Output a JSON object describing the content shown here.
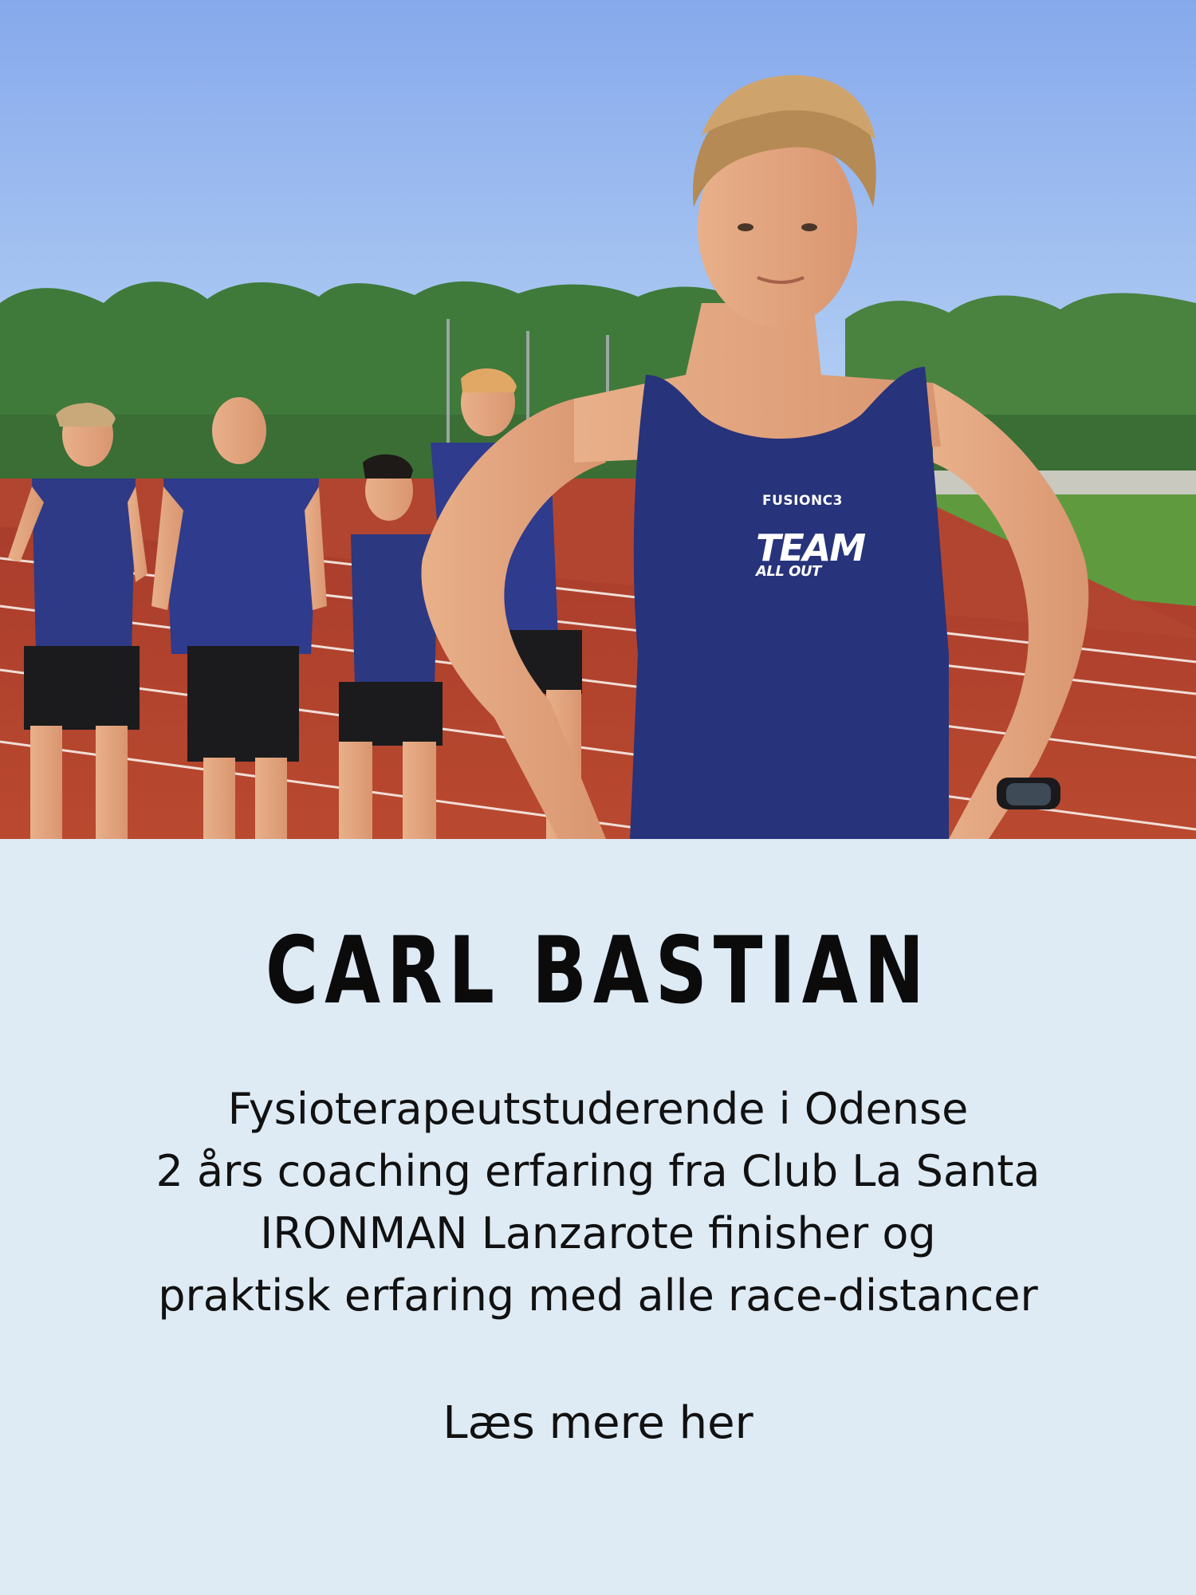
{
  "profile": {
    "name": "CARL BASTIAN",
    "bio_lines": [
      "Fysioterapeutstuderende i Odense",
      "2 års coaching  erfaring fra Club La Santa",
      "IRONMAN Lanzarote finisher  og",
      "praktisk erfaring med alle race-distancer"
    ],
    "read_more": "Læs mere her"
  },
  "photo": {
    "jersey_brand": "FUSIONC3",
    "jersey_team_top": "TEAM",
    "jersey_team_bottom": "ALL OUT"
  },
  "colors": {
    "panel_bg": "#deebf5",
    "jersey_navy": "#27337a",
    "track_red": "#b0402e",
    "sky": "#8fb4ee"
  }
}
